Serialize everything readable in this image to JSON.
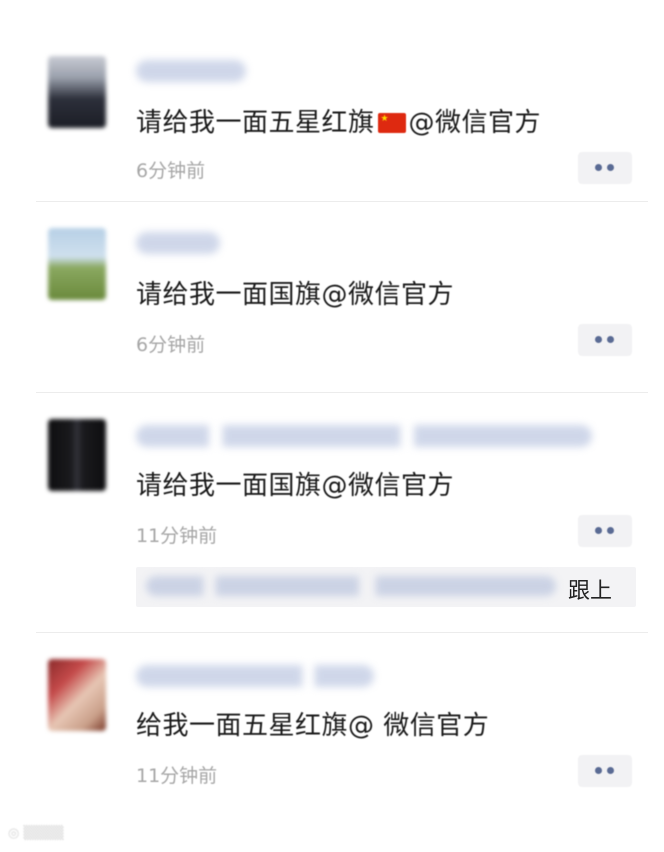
{
  "comments": [
    {
      "content_pre": "请给我一面五星红旗",
      "content_post": "@微信官方",
      "has_flag_emoji": true,
      "flag_icon": "china-flag-icon",
      "time": "6分钟前",
      "more_icon": "more-dots-icon"
    },
    {
      "content": "请给我一面国旗@微信官方",
      "time": "6分钟前",
      "more_icon": "more-dots-icon"
    },
    {
      "content": "请给我一面国旗@微信官方",
      "time": "11分钟前",
      "more_icon": "more-dots-icon",
      "reply_action": "跟上"
    },
    {
      "content": "给我一面五星红旗@ 微信官方",
      "time": "11分钟前",
      "more_icon": "more-dots-icon"
    }
  ],
  "colors": {
    "time_gray": "#a6a6a6",
    "dot_blue": "#5a6b94",
    "flag_red": "#de2910",
    "flag_yellow": "#ffde00"
  }
}
